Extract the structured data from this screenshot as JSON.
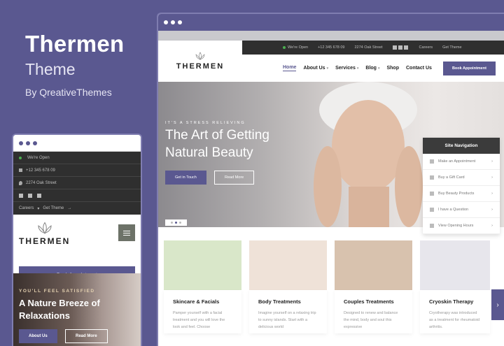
{
  "promo": {
    "title": "Thermen",
    "subtitle": "Theme",
    "by": "By QreativeThemes"
  },
  "desktop": {
    "info": {
      "open": "We're Open",
      "phone": "+12 345 678 09",
      "address": "2274 Oak Street",
      "careers": "Careers",
      "get_theme": "Get Theme"
    },
    "logo": "THERMEN",
    "nav": [
      "Home",
      "About Us",
      "Services",
      "Blog",
      "Shop",
      "Contact Us"
    ],
    "book": "Book Appointment",
    "hero": {
      "kicker": "IT'S A STRESS RELIEVING",
      "title": "The Art of Getting Natural Beauty",
      "btn_primary": "Get in Touch",
      "btn_secondary": "Read More"
    },
    "site_nav": {
      "title": "Site Navigation",
      "items": [
        "Make an Appointment",
        "Buy a Gift Card",
        "Buy Beauty Products",
        "I have a Question",
        "View Opening Hours"
      ]
    },
    "cards": [
      {
        "title": "Skincare & Facials",
        "text": "Pamper yourself with a facial treatment and you will love the look and feel. Choose",
        "color": "#d9e7c9"
      },
      {
        "title": "Body Treatments",
        "text": "Imagine yourself on a relaxing trip to sunny islands. Start with a delicious world",
        "color": "#efe2d8"
      },
      {
        "title": "Couples Treatments",
        "text": "Designed to renew and balance the mind, body and soul this expressive",
        "color": "#d8c2ae"
      },
      {
        "title": "Cryoskin Therapy",
        "text": "Cryotherapy was introduced as a treatment for rheumatoid arthritis.",
        "color": "#e7e6ec"
      }
    ]
  },
  "mobile": {
    "open": "We're Open",
    "phone": "+12 345 678 09",
    "address": "2274 Oak Street",
    "careers": "Careers",
    "get_theme": "Get Theme",
    "logo": "THERMEN",
    "book": "Book Appointment",
    "hero": {
      "kicker": "YOU'LL FEEL SATISFIED",
      "title": "A Nature Breeze of Relaxations",
      "btn_primary": "About Us",
      "btn_secondary": "Read More"
    }
  },
  "colors": {
    "accent": "#5a5890",
    "dark_bar": "#2f2f2f"
  }
}
